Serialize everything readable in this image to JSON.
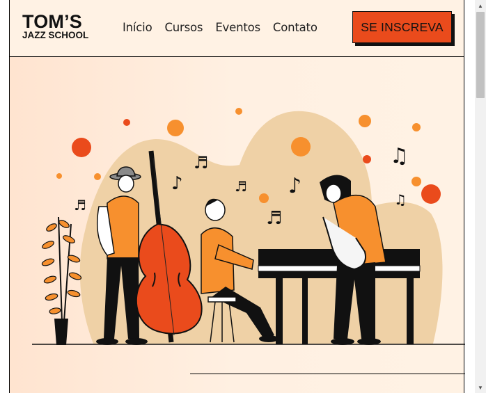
{
  "brand": {
    "name": "TOM’S",
    "subtitle": "JAZZ SCHOOL"
  },
  "nav": {
    "items": [
      "Início",
      "Cursos",
      "Eventos",
      "Contato"
    ]
  },
  "cta": {
    "label": "SE INSCREVA"
  },
  "colors": {
    "accent": "#ea4b1c",
    "orange": "#f7902e",
    "header_bg": "#fff2e4",
    "hero_blob": "#efd1a6"
  },
  "hero": {
    "illustration": "jazz-band-illustration"
  },
  "scrollbar": {
    "up_icon": "▲",
    "down_icon": "▼"
  }
}
